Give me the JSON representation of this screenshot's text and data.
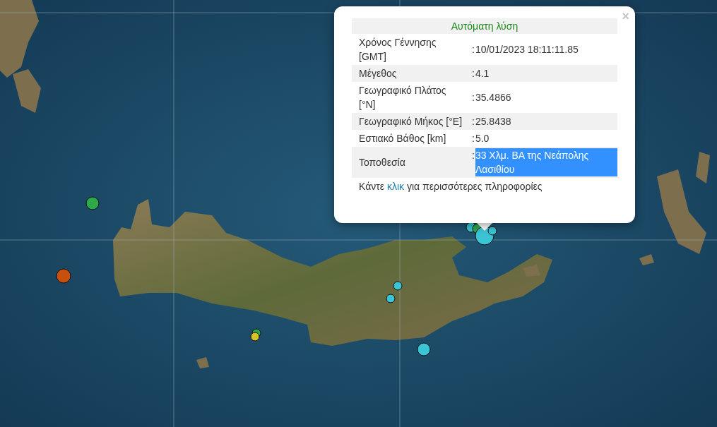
{
  "markers": [
    {
      "color": "#2ea84a"
    },
    {
      "color": "#c8500f"
    },
    {
      "color": "#3bc4d4"
    },
    {
      "color": "#3bc4d4"
    },
    {
      "color": "#2ea84a"
    },
    {
      "color": "#d4c22a"
    },
    {
      "color": "#3bc4d4"
    },
    {
      "color": "#3bc4d4"
    },
    {
      "color": "#2ea84a"
    },
    {
      "color": "#3bc4d4"
    },
    {
      "color": "#3bc4d4"
    }
  ],
  "popup": {
    "close": "×",
    "title": "Αυτόματη λύση",
    "rows": [
      {
        "label": "Χρόνος Γέννησης [GMT]",
        "colon": ":",
        "value": "10/01/2023 18:11:11.85",
        "selected": false
      },
      {
        "label": "Μέγεθος",
        "colon": ":",
        "value": "4.1",
        "selected": false
      },
      {
        "label": "Γεωγραφικό Πλάτος [°N]",
        "colon": ":",
        "value": "35.4866",
        "selected": false
      },
      {
        "label": "Γεωγραφικό Μήκος [°E]",
        "colon": ":",
        "value": "25.8438",
        "selected": false
      },
      {
        "label": "Εστιακό Βάθος [km]",
        "colon": ":",
        "value": "5.0",
        "selected": false
      },
      {
        "label": "Τοποθεσία",
        "colon": ":",
        "value": "33 Χλμ. ΒΑ της Νεάπολης Λασιθίου",
        "selected": true
      }
    ],
    "more_info": {
      "before": "Κάντε",
      "link": "κλικ",
      "after": "για περισσότερες πληροφορίες"
    }
  }
}
